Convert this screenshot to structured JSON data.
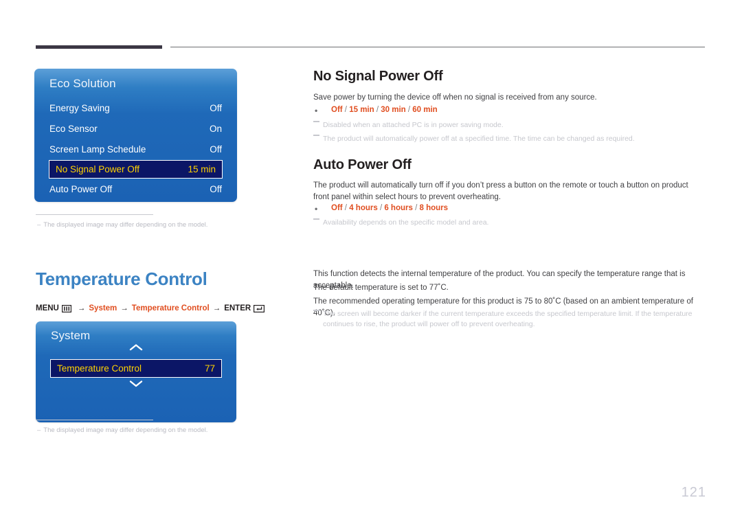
{
  "page": {
    "number": "121"
  },
  "eco_panel": {
    "title": "Eco Solution",
    "rows": [
      {
        "label": "Energy Saving",
        "value": "Off",
        "selected": false
      },
      {
        "label": "Eco Sensor",
        "value": "On",
        "selected": false
      },
      {
        "label": "Screen Lamp Schedule",
        "value": "Off",
        "selected": false
      },
      {
        "label": "No Signal Power Off",
        "value": "15 min",
        "selected": true
      },
      {
        "label": "Auto Power Off",
        "value": "Off",
        "selected": false
      }
    ],
    "note": "The displayed image may differ depending on the model.",
    "note_dash": "–"
  },
  "system_panel": {
    "title": "System",
    "up_icon": "chevron-up-icon",
    "down_icon": "chevron-down-icon",
    "rows": [
      {
        "label": "Temperature Control",
        "value": "77",
        "selected": true
      }
    ],
    "note": "The displayed image may differ depending on the model.",
    "note_dash": "–"
  },
  "no_signal_power_off": {
    "heading": "No Signal Power Off",
    "description": "Save power by turning the device off when no signal is received from any source.",
    "bullet": {
      "dot": "•",
      "parts": [
        "Off",
        "15 min",
        "30 min",
        "60 min"
      ],
      "separator": " / "
    },
    "notes": [
      "Disabled when an attached PC is in power saving mode.",
      "The product will automatically power off at a specified time. The time can be changed as required."
    ]
  },
  "auto_power_off": {
    "heading": "Auto Power Off",
    "description": "The product will automatically turn off if you don’t press a button on the remote or touch a button on product front panel within select hours to prevent overheating.",
    "bullet": {
      "dot": "•",
      "parts": [
        "Off",
        "4 hours",
        "6 hours",
        "8 hours"
      ],
      "separator": " / "
    },
    "notes": [
      "Availability depends on the specific model and area."
    ]
  },
  "temperature_control": {
    "heading": "Temperature Control",
    "menu_path": {
      "menu_label": "MENU",
      "menu_icon": "menu-grid-icon",
      "arrow": "→",
      "step1": "System",
      "step2": "Temperature Control",
      "enter_label": "ENTER",
      "enter_icon": "enter-return-icon"
    },
    "paragraphs": [
      "This function detects the internal temperature of the product. You can specify the temperature range that is acceptable.",
      "The default temperature is set to 77˚C.",
      "The recommended operating temperature for this product is 75 to 80˚C (based on an ambient temperature of 40˚C)."
    ],
    "notes": [
      "The screen will become darker if the current temperature exceeds the specified temperature limit. If the temperature continues to rise, the product will power off to prevent overheating."
    ]
  },
  "colors": {
    "accent_blue": "#3c83c3",
    "accent_red": "#e04e20",
    "osd_blue": "#1b62b4",
    "osd_highlight": "#0b1666",
    "osd_highlight_text": "#ffd200",
    "note_gray": "#c6c7cd"
  }
}
